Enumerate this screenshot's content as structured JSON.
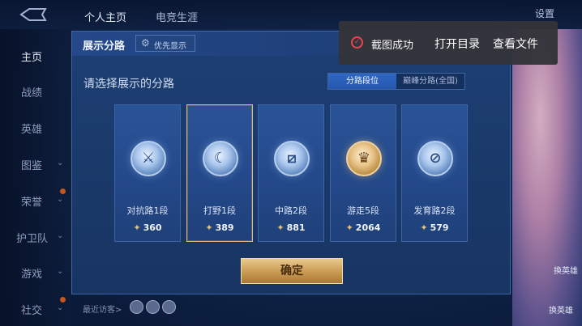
{
  "header": {
    "tabs": [
      "个人主页",
      "电竞生涯"
    ],
    "settings_label": "设置"
  },
  "sidebar": {
    "items": [
      {
        "label": "主页",
        "active": true,
        "chevron": false
      },
      {
        "label": "战绩",
        "active": false,
        "chevron": false
      },
      {
        "label": "英雄",
        "active": false,
        "chevron": false
      },
      {
        "label": "图鉴",
        "active": false,
        "chevron": true
      },
      {
        "label": "荣誉",
        "active": false,
        "chevron": true
      },
      {
        "label": "护卫队",
        "active": false,
        "chevron": true
      },
      {
        "label": "游戏",
        "active": false,
        "chevron": true
      },
      {
        "label": "社交",
        "active": false,
        "chevron": true
      }
    ],
    "recent_visitors_label": "最近访客>"
  },
  "right_panel": {
    "label_1": "换英雄",
    "label_2": "换英雄"
  },
  "modal": {
    "title": "展示分路",
    "priority_button": "优先显示",
    "prompt": "请选择展示的分路",
    "tabs": [
      {
        "label": "分路段位",
        "active": true
      },
      {
        "label": "巅峰分路(全国)",
        "active": false
      }
    ],
    "cards": [
      {
        "name": "对抗路1段",
        "score": "360",
        "icon": "clash-lane-icon",
        "selected": false,
        "gold": false,
        "glyph": "⚔"
      },
      {
        "name": "打野1段",
        "score": "389",
        "icon": "jungle-icon",
        "selected": true,
        "gold": false,
        "glyph": "☾"
      },
      {
        "name": "中路2段",
        "score": "881",
        "icon": "mid-lane-icon",
        "selected": false,
        "gold": false,
        "glyph": "⧄"
      },
      {
        "name": "游走5段",
        "score": "2064",
        "icon": "roam-icon",
        "selected": false,
        "gold": true,
        "glyph": "♛"
      },
      {
        "name": "发育路2段",
        "score": "579",
        "icon": "farm-lane-icon",
        "selected": false,
        "gold": false,
        "glyph": "⊘"
      }
    ],
    "confirm_button": "确定"
  },
  "toast": {
    "message": "截图成功",
    "open_folder": "打开目录",
    "view_file": "查看文件",
    "status_color": "#e6474f"
  }
}
